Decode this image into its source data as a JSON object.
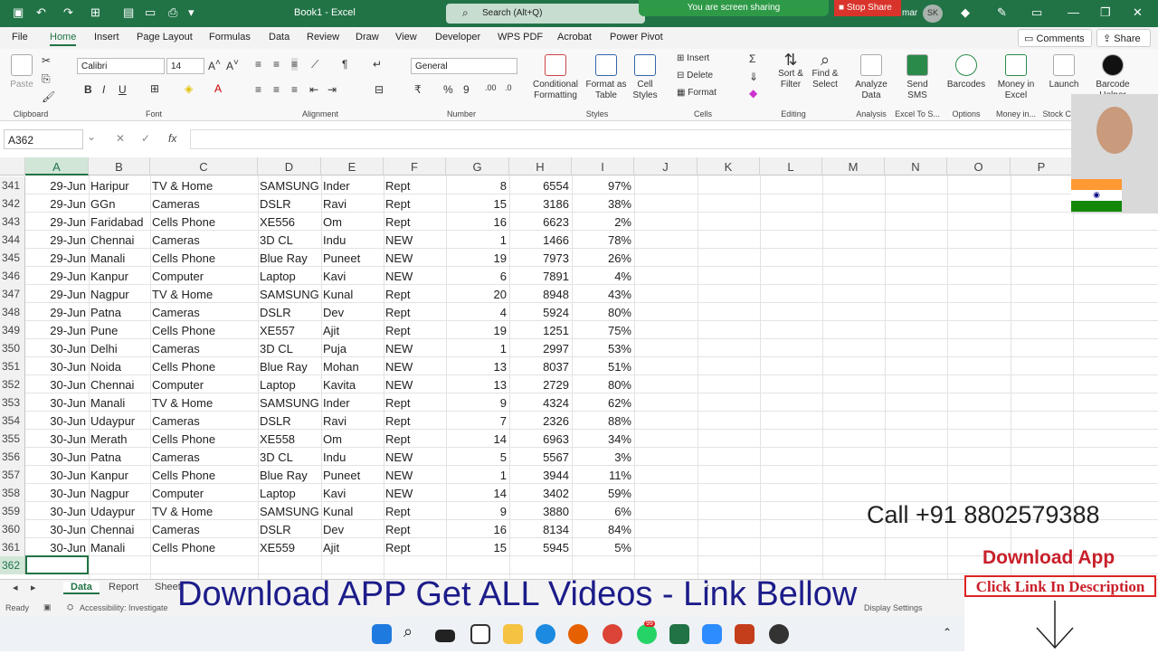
{
  "titlebar": {
    "title": "Book1 - Excel",
    "search_placeholder": "Search (Alt+Q)",
    "share_status": "You are screen sharing",
    "stop_share": "Stop Share",
    "user_initials": "SK",
    "user_name_fragment": "mar"
  },
  "menu": {
    "items": [
      "File",
      "Home",
      "Insert",
      "Page Layout",
      "Formulas",
      "Data",
      "Review",
      "Draw",
      "View",
      "Developer",
      "WPS PDF",
      "Acrobat",
      "Power Pivot"
    ],
    "comments": "Comments",
    "share": "Share"
  },
  "ribbon": {
    "groups": [
      "Clipboard",
      "Font",
      "Alignment",
      "Number",
      "Styles",
      "Cells",
      "Editing",
      "Analysis",
      "Excel To S...",
      "Options",
      "Money in...",
      "Stock C..."
    ],
    "paste": "Paste",
    "font_name": "Calibri",
    "font_size": "14",
    "number_format": "General",
    "conditional_formatting": "Conditional Formatting",
    "format_as_table": "Format as Table",
    "cell_styles": "Cell Styles",
    "insert": "Insert",
    "delete": "Delete",
    "format": "Format",
    "sort_filter": "Sort & Filter",
    "find_select": "Find & Select",
    "analyze_data": "Analyze Data",
    "send_sms": "Send SMS",
    "barcodes": "Barcodes",
    "money_excel": "Money in Excel",
    "launch": "Launch",
    "barcode_helper": "Barcode Helper"
  },
  "formula": {
    "name_box": "A362",
    "fx": "fx",
    "value": ""
  },
  "grid": {
    "columns": [
      "A",
      "B",
      "C",
      "D",
      "E",
      "F",
      "G",
      "H",
      "I",
      "J",
      "K",
      "L",
      "M",
      "N",
      "O",
      "P"
    ],
    "rows": [
      {
        "n": "341",
        "a": "29-Jun",
        "b": "Haripur",
        "c": "TV & Home",
        "d": "SAMSUNG",
        "e": "Inder",
        "f": "Rept",
        "g": "8",
        "h": "6554",
        "i": "97%"
      },
      {
        "n": "342",
        "a": "29-Jun",
        "b": "GGn",
        "c": "Cameras",
        "d": "DSLR",
        "e": "Ravi",
        "f": "Rept",
        "g": "15",
        "h": "3186",
        "i": "38%"
      },
      {
        "n": "343",
        "a": "29-Jun",
        "b": "Faridabad",
        "c": "Cells Phone",
        "d": "XE556",
        "e": "Om",
        "f": "Rept",
        "g": "16",
        "h": "6623",
        "i": "2%"
      },
      {
        "n": "344",
        "a": "29-Jun",
        "b": "Chennai",
        "c": "Cameras",
        "d": "3D CL",
        "e": "Indu",
        "f": "NEW",
        "g": "1",
        "h": "1466",
        "i": "78%"
      },
      {
        "n": "345",
        "a": "29-Jun",
        "b": "Manali",
        "c": "Cells Phone",
        "d": "Blue Ray",
        "e": "Puneet",
        "f": "NEW",
        "g": "19",
        "h": "7973",
        "i": "26%"
      },
      {
        "n": "346",
        "a": "29-Jun",
        "b": "Kanpur",
        "c": "Computer",
        "d": "Laptop",
        "e": "Kavi",
        "f": "NEW",
        "g": "6",
        "h": "7891",
        "i": "4%"
      },
      {
        "n": "347",
        "a": "29-Jun",
        "b": "Nagpur",
        "c": "TV & Home",
        "d": "SAMSUNG",
        "e": "Kunal",
        "f": "Rept",
        "g": "20",
        "h": "8948",
        "i": "43%"
      },
      {
        "n": "348",
        "a": "29-Jun",
        "b": "Patna",
        "c": "Cameras",
        "d": "DSLR",
        "e": "Dev",
        "f": "Rept",
        "g": "4",
        "h": "5924",
        "i": "80%"
      },
      {
        "n": "349",
        "a": "29-Jun",
        "b": "Pune",
        "c": "Cells Phone",
        "d": "XE557",
        "e": "Ajit",
        "f": "Rept",
        "g": "19",
        "h": "1251",
        "i": "75%"
      },
      {
        "n": "350",
        "a": "30-Jun",
        "b": "Delhi",
        "c": "Cameras",
        "d": "3D CL",
        "e": "Puja",
        "f": "NEW",
        "g": "1",
        "h": "2997",
        "i": "53%"
      },
      {
        "n": "351",
        "a": "30-Jun",
        "b": "Noida",
        "c": "Cells Phone",
        "d": "Blue Ray",
        "e": "Mohan",
        "f": "NEW",
        "g": "13",
        "h": "8037",
        "i": "51%"
      },
      {
        "n": "352",
        "a": "30-Jun",
        "b": "Chennai",
        "c": "Computer",
        "d": "Laptop",
        "e": "Kavita",
        "f": "NEW",
        "g": "13",
        "h": "2729",
        "i": "80%"
      },
      {
        "n": "353",
        "a": "30-Jun",
        "b": "Manali",
        "c": "TV & Home",
        "d": "SAMSUNG",
        "e": "Inder",
        "f": "Rept",
        "g": "9",
        "h": "4324",
        "i": "62%"
      },
      {
        "n": "354",
        "a": "30-Jun",
        "b": "Udaypur",
        "c": "Cameras",
        "d": "DSLR",
        "e": "Ravi",
        "f": "Rept",
        "g": "7",
        "h": "2326",
        "i": "88%"
      },
      {
        "n": "355",
        "a": "30-Jun",
        "b": "Merath",
        "c": "Cells Phone",
        "d": "XE558",
        "e": "Om",
        "f": "Rept",
        "g": "14",
        "h": "6963",
        "i": "34%"
      },
      {
        "n": "356",
        "a": "30-Jun",
        "b": "Patna",
        "c": "Cameras",
        "d": "3D CL",
        "e": "Indu",
        "f": "NEW",
        "g": "5",
        "h": "5567",
        "i": "3%"
      },
      {
        "n": "357",
        "a": "30-Jun",
        "b": "Kanpur",
        "c": "Cells Phone",
        "d": "Blue Ray",
        "e": "Puneet",
        "f": "NEW",
        "g": "1",
        "h": "3944",
        "i": "11%"
      },
      {
        "n": "358",
        "a": "30-Jun",
        "b": "Nagpur",
        "c": "Computer",
        "d": "Laptop",
        "e": "Kavi",
        "f": "NEW",
        "g": "14",
        "h": "3402",
        "i": "59%"
      },
      {
        "n": "359",
        "a": "30-Jun",
        "b": "Udaypur",
        "c": "TV & Home",
        "d": "SAMSUNG",
        "e": "Kunal",
        "f": "Rept",
        "g": "9",
        "h": "3880",
        "i": "6%"
      },
      {
        "n": "360",
        "a": "30-Jun",
        "b": "Chennai",
        "c": "Cameras",
        "d": "DSLR",
        "e": "Dev",
        "f": "Rept",
        "g": "16",
        "h": "8134",
        "i": "84%"
      },
      {
        "n": "361",
        "a": "30-Jun",
        "b": "Manali",
        "c": "Cells Phone",
        "d": "XE559",
        "e": "Ajit",
        "f": "Rept",
        "g": "15",
        "h": "5945",
        "i": "5%"
      },
      {
        "n": "362",
        "a": "",
        "b": "",
        "c": "",
        "d": "",
        "e": "",
        "f": "",
        "g": "",
        "h": "",
        "i": ""
      }
    ]
  },
  "sheets": {
    "tabs": [
      "Data",
      "Report",
      "Sheet"
    ],
    "active": "Data"
  },
  "status": {
    "ready": "Ready",
    "accessibility": "Accessibility: Investigate",
    "display_settings": "Display Settings"
  },
  "overlay": {
    "banner": "Download APP Get ALL Videos -  Link Bellow",
    "phone": "Call +91 8802579388",
    "download_app": "Download App",
    "click_link": "Click Link In Description"
  },
  "taskbar_badge": "99",
  "colors": {
    "excel_green": "#217346",
    "banner_blue": "#1c1c8a",
    "cta_red": "#c8202a"
  }
}
